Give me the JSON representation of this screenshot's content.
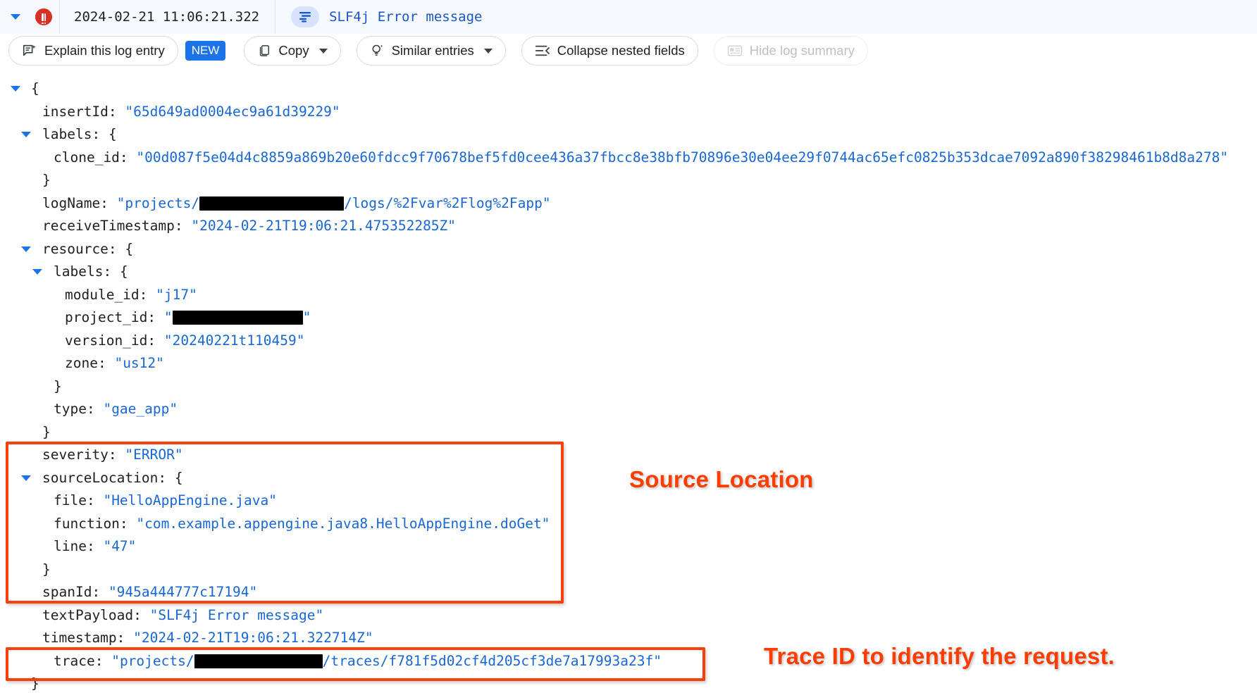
{
  "header": {
    "expand_icon": "chevron-down-icon",
    "severity_icon": "error-severity-icon",
    "timestamp": "2024-02-21 11:06:21.322",
    "summary_icon": "log-summary-icon",
    "summary_text": "SLF4j Error message"
  },
  "toolbar": {
    "explain_label": "Explain this log entry",
    "new_badge": "NEW",
    "copy_label": "Copy",
    "similar_label": "Similar entries",
    "collapse_label": "Collapse nested fields",
    "hide_summary_label": "Hide log summary"
  },
  "json": {
    "open_brace": "{",
    "close_brace": "}",
    "lines": {
      "insertId_key": "insertId:",
      "insertId_value": "\"65d649ad0004ec9a61d39229\"",
      "labels_key": "labels:",
      "clone_id_key": "clone_id:",
      "clone_id_value": "\"00d087f5e04d4c8859a869b20e60fdcc9f70678bef5fd0cee436a37fbcc8e38bfb70896e30e04ee29f0744ac65efc0825b353dcae7092a890f38298461b8d8a278\"",
      "logName_key": "logName:",
      "logName_prefix": "\"projects/",
      "logName_suffix": "/logs/%2Fvar%2Flog%2Fapp\"",
      "receiveTimestamp_key": "receiveTimestamp:",
      "receiveTimestamp_value": "\"2024-02-21T19:06:21.475352285Z\"",
      "resource_key": "resource:",
      "resource_labels_key": "labels:",
      "module_id_key": "module_id:",
      "module_id_value": "\"j17\"",
      "project_id_key": "project_id:",
      "project_id_quote_open": "\"",
      "project_id_quote_close": "\"",
      "version_id_key": "version_id:",
      "version_id_value": "\"20240221t110459\"",
      "zone_key": "zone:",
      "zone_value": "\"us12\"",
      "type_key": "type:",
      "type_value": "\"gae_app\"",
      "severity_key": "severity:",
      "severity_value": "\"ERROR\"",
      "sourceLocation_key": "sourceLocation:",
      "file_key": "file:",
      "file_value": "\"HelloAppEngine.java\"",
      "function_key": "function:",
      "function_value": "\"com.example.appengine.java8.HelloAppEngine.doGet\"",
      "line_key": "line:",
      "line_value": "\"47\"",
      "spanId_key": "spanId:",
      "spanId_value": "\"945a444777c17194\"",
      "textPayload_key": "textPayload:",
      "textPayload_value": "\"SLF4j Error message\"",
      "timestamp_key": "timestamp:",
      "timestamp_value": "\"2024-02-21T19:06:21.322714Z\"",
      "trace_key": "trace:",
      "trace_prefix": "\"projects/",
      "trace_suffix": "/traces/f781f5d02cf4d205cf3de7a17993a23f\""
    },
    "brace_open": "{",
    "brace_close": "}"
  },
  "annotations": {
    "source_location": "Source Location",
    "trace_id": "Trace ID to identify the request.",
    "color": "#ff3d00"
  },
  "colors": {
    "key": "#202124",
    "value": "#1967d2",
    "accent": "#1a73e8",
    "error": "#d93025",
    "header_bg": "#f5f8fd",
    "summary_chip_bg": "#d7e3fc"
  }
}
